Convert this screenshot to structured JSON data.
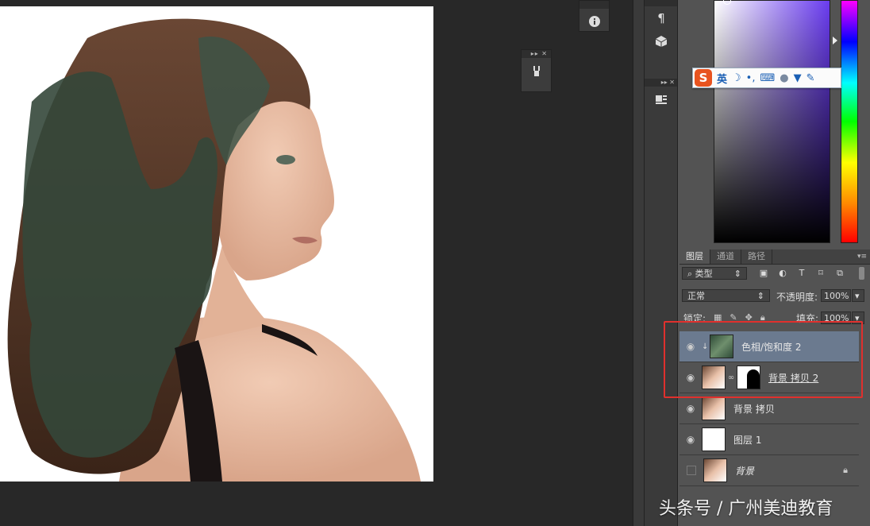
{
  "colors": {
    "workspace": "#282828",
    "panel": "#535353",
    "highlight_box": "#e0302d",
    "active_layer": "#6b7a8f"
  },
  "ime_toolbar": {
    "logo": "S",
    "mode": "英",
    "moon": "☽",
    "punct": "•,",
    "keyboard": "⌨",
    "user": "👤",
    "shirt": "👕",
    "wrench": "🔧"
  },
  "layers_panel": {
    "tabs": [
      "图层",
      "通道",
      "路径"
    ],
    "filter_label": "类型",
    "blend_mode": "正常",
    "opacity_label": "不透明度:",
    "opacity_value": "100%",
    "lock_label": "锁定:",
    "fill_label": "填充:",
    "fill_value": "100%",
    "layers": [
      {
        "name": "色相/饱和度 2",
        "visible": true,
        "active": true
      },
      {
        "name": "背景 拷贝 2",
        "visible": true,
        "active": false
      },
      {
        "name": "背景 拷贝",
        "visible": true,
        "active": false
      },
      {
        "name": "图层 1",
        "visible": true,
        "active": false
      },
      {
        "name": "背景",
        "visible": false,
        "active": false
      }
    ]
  },
  "watermark": "头条号 / 广州美迪教育"
}
